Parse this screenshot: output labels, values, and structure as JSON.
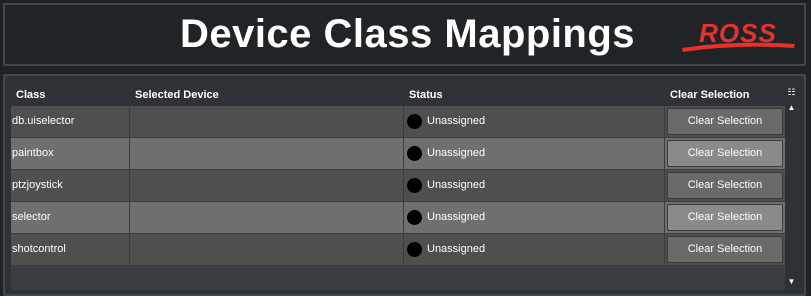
{
  "header": {
    "title": "Device Class Mappings",
    "logo_text": "ROSS",
    "logo_color": "#e8312a"
  },
  "table": {
    "columns": [
      "Class",
      "Selected Device",
      "Status",
      "Clear Selection"
    ],
    "rows": [
      {
        "class": "db.uiselector",
        "selected_device": "",
        "status": "Unassigned",
        "button": "Clear Selection"
      },
      {
        "class": "paintbox",
        "selected_device": "",
        "status": "Unassigned",
        "button": "Clear Selection"
      },
      {
        "class": "ptzjoystick",
        "selected_device": "",
        "status": "Unassigned",
        "button": "Clear Selection"
      },
      {
        "class": "selector",
        "selected_device": "",
        "status": "Unassigned",
        "button": "Clear Selection"
      },
      {
        "class": "shotcontrol",
        "selected_device": "",
        "status": "Unassigned",
        "button": "Clear Selection"
      }
    ]
  },
  "scrollbar": {
    "menu_icon": "column-menu-icon",
    "up_icon": "scroll-up-icon",
    "down_icon": "scroll-down-icon"
  }
}
